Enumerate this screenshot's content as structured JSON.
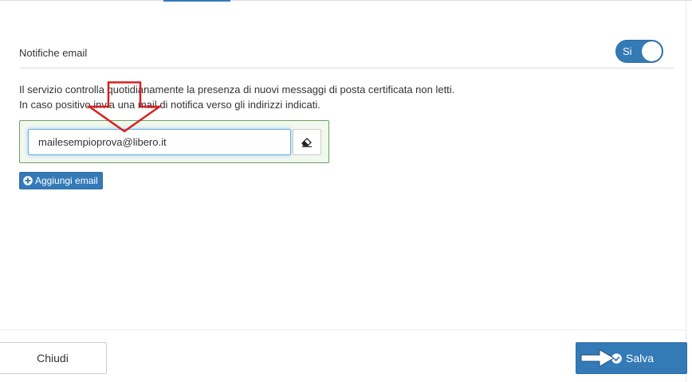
{
  "notifications": {
    "label": "Notifiche email",
    "toggle_label": "Si"
  },
  "description": {
    "line1": "Il servizio controlla quotidianamente la presenza di nuovi messaggi di posta certificata non letti.",
    "line2": "In caso positivo invia una mail di notifica verso gli indirizzi indicati."
  },
  "email_list": {
    "entries": [
      {
        "value": "mailesempioprova@libero.it"
      }
    ],
    "add_label": "Aggiungi email"
  },
  "footer": {
    "close_label": "Chiudi",
    "save_label": "Salva"
  },
  "colors": {
    "primary": "#337ab7",
    "panel_bg": "#f1f8ee",
    "panel_border": "#6f9e60",
    "annotation_red": "#d9201f"
  },
  "icons": {
    "toggle": "toggle-switch",
    "clear": "eraser-icon",
    "add": "plus-circle-icon",
    "save": "check-circle-icon"
  }
}
